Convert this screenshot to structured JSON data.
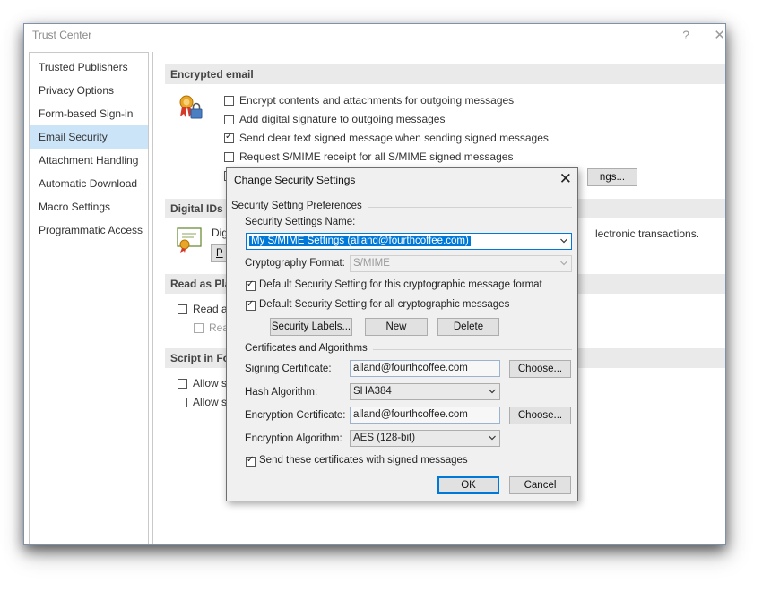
{
  "window": {
    "title": "Trust Center",
    "help": "?",
    "close": "✕"
  },
  "sidebar": {
    "items": [
      {
        "label": "Trusted Publishers"
      },
      {
        "label": "Privacy Options"
      },
      {
        "label": "Form-based Sign-in"
      },
      {
        "label": "Email Security"
      },
      {
        "label": "Attachment Handling"
      },
      {
        "label": "Automatic Download"
      },
      {
        "label": "Macro Settings"
      },
      {
        "label": "Programmatic Access"
      }
    ],
    "active": "Email Security"
  },
  "main": {
    "encrypted": {
      "header": "Encrypted email",
      "options": [
        {
          "label": "Encrypt contents and attachments for outgoing messages",
          "checked": false
        },
        {
          "label": "Add digital signature to outgoing messages",
          "checked": false
        },
        {
          "label": "Send clear text signed message when sending signed messages",
          "checked": true
        },
        {
          "label": "Request S/MIME receipt for all S/MIME signed messages",
          "checked": false
        }
      ],
      "partial_cb_label": "D",
      "settings_button": "ngs..."
    },
    "digital_ids": {
      "header": "Digital IDs (",
      "text_left": "Dig",
      "text_right": "lectronic transactions.",
      "button_partial": "P"
    },
    "read_plain": {
      "header": "Read as Plain",
      "opt1": "Read al",
      "opt2": "Rea"
    },
    "script": {
      "header": "Script in Fol",
      "opt1": "Allow s",
      "opt2": "Allow s"
    }
  },
  "dialog": {
    "title": "Change Security Settings",
    "close": "✕",
    "prefs_group": "Security Setting Preferences",
    "name_label": "Security Settings Name:",
    "name_value": "My S/MIME Settings (alland@fourthcoffee.com)",
    "crypto_label": "Cryptography Format:",
    "crypto_value": "S/MIME",
    "default_format": {
      "label": "Default Security Setting for this cryptographic message format",
      "checked": true
    },
    "default_all": {
      "label": "Default Security Setting for all cryptographic messages",
      "checked": true
    },
    "buttons": {
      "labels": "Security Labels...",
      "new": "New",
      "delete": "Delete",
      "ok": "OK",
      "cancel": "Cancel",
      "choose": "Choose..."
    },
    "certs_group": "Certificates and Algorithms",
    "signing_label": "Signing Certificate:",
    "signing_value": "alland@fourthcoffee.com",
    "hash_label": "Hash Algorithm:",
    "hash_value": "SHA384",
    "enc_cert_label": "Encryption Certificate:",
    "enc_cert_value": "alland@fourthcoffee.com",
    "enc_alg_label": "Encryption Algorithm:",
    "enc_alg_value": "AES (128-bit)",
    "send_certs": {
      "label": "Send these certificates with signed messages",
      "checked": true
    }
  }
}
